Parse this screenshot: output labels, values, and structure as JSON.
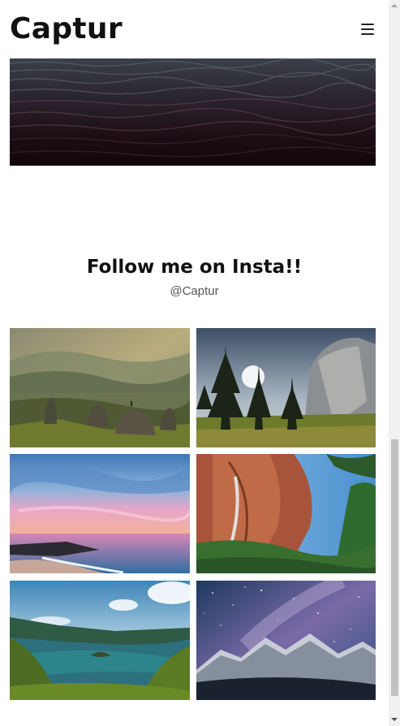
{
  "navbar": {
    "logo": "Captur",
    "menu_icon": "hamburger-icon"
  },
  "hero": {
    "image": "dark ocean waves"
  },
  "instagram": {
    "title": "Follow me on Insta!!",
    "handle": "@Captur",
    "photos": [
      {
        "subject": "misty valley with rock formations"
      },
      {
        "subject": "granite cliff with pine trees"
      },
      {
        "subject": "pink sunset over ocean shore"
      },
      {
        "subject": "waterfall on red canyon wall"
      },
      {
        "subject": "blue lake with island and forest"
      },
      {
        "subject": "milky way over snowy mountains"
      }
    ]
  },
  "colors": {
    "text": "#111111",
    "muted": "#555555",
    "background": "#ffffff"
  }
}
